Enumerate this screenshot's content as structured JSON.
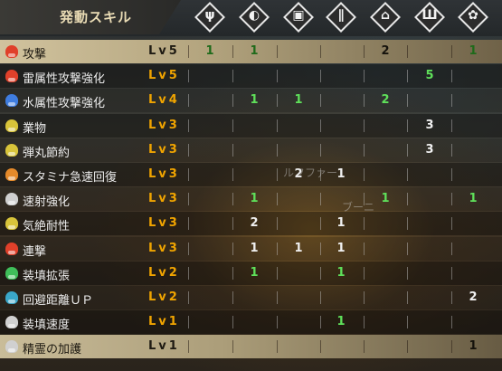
{
  "header": {
    "title": "発動スキル"
  },
  "equipment_icons": [
    "weapon-icon",
    "helm-icon",
    "chest-icon",
    "arm-icon",
    "waist-icon",
    "leg-icon",
    "charm-icon"
  ],
  "icon_glyphs": [
    "ψ",
    "◐",
    "▣",
    "∥",
    "⌂",
    "Ш",
    "✿"
  ],
  "colors": {
    "level": "#f0a400",
    "contrib_green": "#5fe05a",
    "contrib_white": "#f0f0f0"
  },
  "background_text": [
    "ルフファー",
    "ブーニ"
  ],
  "skills": [
    {
      "name": "攻撃",
      "level": "Lv5",
      "icon_color": "#e0402a",
      "cells": [
        [
          "1",
          "g"
        ],
        [
          "1",
          "g"
        ],
        "",
        "",
        [
          "2",
          "w"
        ],
        "",
        [
          "1",
          "g"
        ]
      ]
    },
    {
      "name": "雷属性攻撃強化",
      "level": "Lv5",
      "icon_color": "#e0402a",
      "cells": [
        "",
        "",
        "",
        "",
        "",
        [
          "5",
          "g"
        ],
        ""
      ]
    },
    {
      "name": "水属性攻撃強化",
      "level": "Lv4",
      "icon_color": "#3f7de0",
      "cells": [
        "",
        [
          "1",
          "g"
        ],
        [
          "1",
          "g"
        ],
        "",
        [
          "2",
          "g"
        ],
        "",
        ""
      ]
    },
    {
      "name": "業物",
      "level": "Lv3",
      "icon_color": "#d8c43a",
      "cells": [
        "",
        "",
        "",
        "",
        "",
        [
          "3",
          "w"
        ],
        ""
      ]
    },
    {
      "name": "弾丸節約",
      "level": "Lv3",
      "icon_color": "#d8c43a",
      "cells": [
        "",
        "",
        "",
        "",
        "",
        [
          "3",
          "w"
        ],
        ""
      ]
    },
    {
      "name": "スタミナ急速回復",
      "level": "Lv3",
      "icon_color": "#e58a2a",
      "cells": [
        "",
        "",
        [
          "2",
          "w"
        ],
        [
          "1",
          "w"
        ],
        "",
        "",
        ""
      ]
    },
    {
      "name": "速射強化",
      "level": "Lv3",
      "icon_color": "#d0d0d0",
      "cells": [
        "",
        [
          "1",
          "g"
        ],
        "",
        "",
        [
          "1",
          "g"
        ],
        "",
        [
          "1",
          "g"
        ]
      ]
    },
    {
      "name": "気絶耐性",
      "level": "Lv3",
      "icon_color": "#d8c43a",
      "cells": [
        "",
        [
          "2",
          "w"
        ],
        "",
        [
          "1",
          "w"
        ],
        "",
        "",
        ""
      ]
    },
    {
      "name": "連撃",
      "level": "Lv3",
      "icon_color": "#e0402a",
      "cells": [
        "",
        [
          "1",
          "w"
        ],
        [
          "1",
          "w"
        ],
        [
          "1",
          "w"
        ],
        "",
        "",
        ""
      ]
    },
    {
      "name": "装填拡張",
      "level": "Lv2",
      "icon_color": "#3fbf5a",
      "cells": [
        "",
        [
          "1",
          "g"
        ],
        "",
        [
          "1",
          "g"
        ],
        "",
        "",
        ""
      ]
    },
    {
      "name": "回避距離ＵＰ",
      "level": "Lv2",
      "icon_color": "#3aa7c9",
      "cells": [
        "",
        "",
        "",
        "",
        "",
        "",
        [
          "2",
          "w"
        ]
      ]
    },
    {
      "name": "装填速度",
      "level": "Lv1",
      "icon_color": "#d0d0d0",
      "cells": [
        "",
        "",
        "",
        [
          "1",
          "g"
        ],
        "",
        "",
        ""
      ]
    },
    {
      "name": "精霊の加護",
      "level": "Lv1",
      "icon_color": "#d0d0d0",
      "cells": [
        "",
        "",
        "",
        "",
        "",
        "",
        [
          "1",
          "w"
        ]
      ]
    }
  ]
}
